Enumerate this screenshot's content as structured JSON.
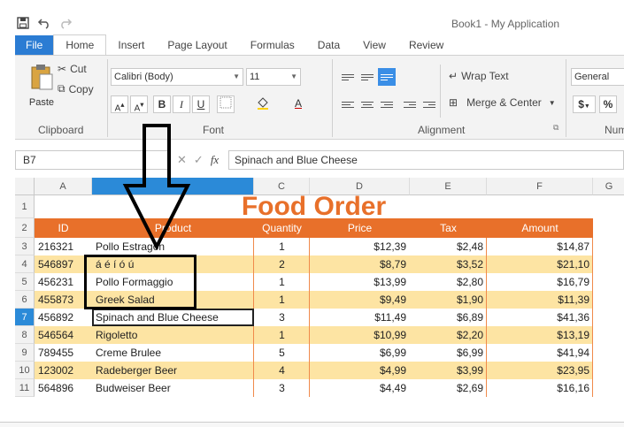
{
  "window": {
    "title": "Book1 - My Application"
  },
  "quick_access": {
    "icons": [
      "save-icon",
      "undo-icon",
      "redo-icon"
    ]
  },
  "tabs": [
    {
      "label": "File"
    },
    {
      "label": "Home"
    },
    {
      "label": "Insert"
    },
    {
      "label": "Page Layout"
    },
    {
      "label": "Formulas"
    },
    {
      "label": "Data"
    },
    {
      "label": "View"
    },
    {
      "label": "Review"
    }
  ],
  "ribbon": {
    "clipboard": {
      "label": "Clipboard",
      "paste": "Paste",
      "cut": "Cut",
      "copy": "Copy"
    },
    "font": {
      "label": "Font",
      "family": "Calibri (Body)",
      "size": "11",
      "bold": "B",
      "italic": "I",
      "underline": "U",
      "font_color": "A"
    },
    "alignment": {
      "label": "Alignment",
      "wrap_text": "Wrap Text",
      "merge_center": "Merge & Center"
    },
    "number": {
      "label": "Num",
      "format": "General",
      "currency": "$",
      "percent": "%"
    }
  },
  "formula_bar": {
    "name_box": "B7",
    "fx": "fx",
    "value": "Spinach and Blue Cheese"
  },
  "columns": [
    "A",
    "B",
    "C",
    "D",
    "E",
    "F",
    "G"
  ],
  "rows": [
    "1",
    "2",
    "3",
    "4",
    "5",
    "6",
    "7",
    "8",
    "9",
    "10",
    "11"
  ],
  "sheet": {
    "title": "Food Order",
    "headers": [
      "ID",
      "Product",
      "Quantity",
      "Price",
      "Tax",
      "Amount"
    ],
    "data": [
      [
        "216321",
        "Pollo Estragón",
        "1",
        "$12,39",
        "$2,48",
        "$14,87"
      ],
      [
        "546897",
        "á é í ó ú",
        "2",
        "$8,79",
        "$3,52",
        "$21,10"
      ],
      [
        "456231",
        "Pollo Formaggio",
        "1",
        "$13,99",
        "$2,80",
        "$16,79"
      ],
      [
        "455873",
        "Greek Salad",
        "1",
        "$9,49",
        "$1,90",
        "$11,39"
      ],
      [
        "456892",
        "Spinach and Blue Cheese",
        "3",
        "$11,49",
        "$6,89",
        "$41,36"
      ],
      [
        "546564",
        "Rigoletto",
        "1",
        "$10,99",
        "$2,20",
        "$13,19"
      ],
      [
        "789455",
        "Creme Brulee",
        "5",
        "$6,99",
        "$6,99",
        "$41,94"
      ],
      [
        "123002",
        "Radeberger Beer",
        "4",
        "$4,99",
        "$3,99",
        "$23,95"
      ],
      [
        "564896",
        "Budweiser Beer",
        "3",
        "$4,49",
        "$2,69",
        "$16,16"
      ]
    ]
  },
  "colors": {
    "accent": "#e8702a",
    "band": "#fde4a3",
    "selection": "#2b8ad8",
    "file_tab": "#2b7cd3"
  }
}
